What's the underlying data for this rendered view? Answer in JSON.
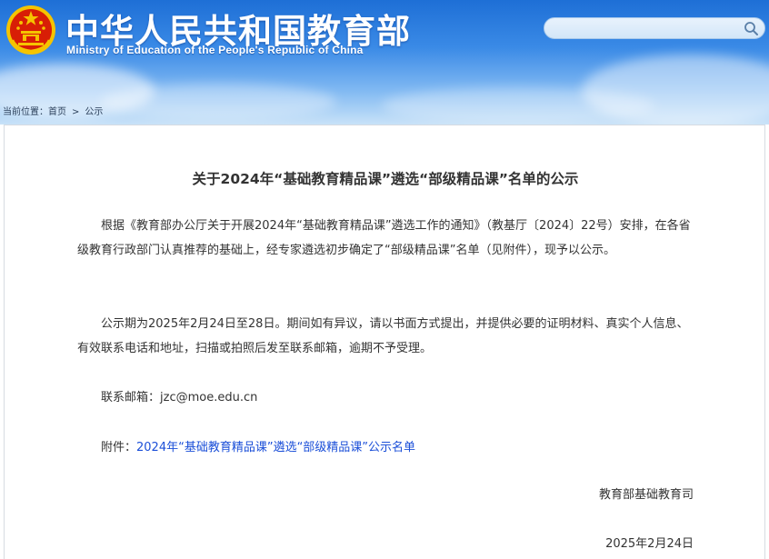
{
  "header": {
    "site_title_cn": "中华人民共和国教育部",
    "site_title_en": "Ministry of Education of the People's Republic of China",
    "search": {
      "value": "",
      "placeholder": ""
    }
  },
  "breadcrumb": {
    "prefix": "当前位置：",
    "items": [
      "首页",
      "公示"
    ],
    "separator": ">"
  },
  "article": {
    "title": "关于2024年“基础教育精品课”遴选“部级精品课”名单的公示",
    "paragraph_1": "根据《教育部办公厅关于开展2024年“基础教育精品课”遴选工作的通知》（教基厅〔2024〕22号）安排，在各省级教育行政部门认真推荐的基础上，经专家遴选初步确定了“部级精品课”名单（见附件），现予以公示。",
    "paragraph_2": "公示期为2025年2月24日至28日。期间如有异议，请以书面方式提出，并提供必要的证明材料、真实个人信息、有效联系电话和地址，扫描或拍照后发至联系邮箱，逾期不予受理。",
    "contact_label": "联系邮箱：",
    "contact_email": "jzc@moe.edu.cn",
    "attachment_label": "附件：",
    "attachment_link": "2024年“基础教育精品课”遴选“部级精品课”公示名单",
    "signature_department": "教育部基础教育司",
    "signature_date": "2025年2月24日"
  },
  "colors": {
    "header_blue": "#1e6fd6",
    "link_blue": "#1b4fd8",
    "text": "#333333",
    "emblem_red": "#d81e06",
    "emblem_gold": "#f5c400"
  },
  "icons": {
    "emblem": "national-emblem-icon",
    "search": "search-icon"
  }
}
